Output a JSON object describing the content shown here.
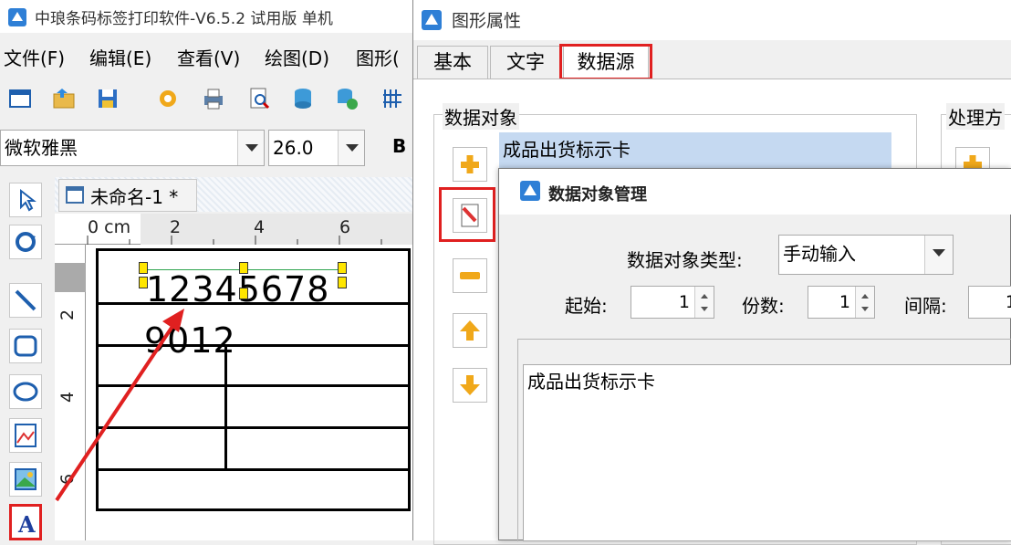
{
  "main_window": {
    "title": "中琅条码标签打印软件-V6.5.2 试用版 单机",
    "menu": [
      "文件(F)",
      "编辑(E)",
      "查看(V)",
      "绘图(D)",
      "图形("
    ],
    "font": {
      "family": "微软雅黑",
      "size": "26.0",
      "bold_label": "B"
    },
    "doc_tab": "未命名-1 *",
    "ruler": {
      "unit": "0 cm",
      "top_ticks": [
        "2",
        "4",
        "6"
      ],
      "left_ticks": [
        "2",
        "4",
        "6"
      ]
    },
    "label": {
      "text_line1": "12345678",
      "text_line2": "9012"
    }
  },
  "property_dialog": {
    "title": "图形属性",
    "tabs": [
      "基本",
      "文字",
      "数据源"
    ],
    "active_tab": "数据源",
    "group_label": "数据对象",
    "processing_label": "处理方",
    "data_item": "成品出货标示卡"
  },
  "data_manager": {
    "title": "数据对象管理",
    "type_label": "数据对象类型:",
    "type_value": "手动输入",
    "start_label": "起始:",
    "start_value": "1",
    "copies_label": "份数:",
    "copies_value": "1",
    "interval_label": "间隔:",
    "interval_value": "1",
    "content": "成品出货标示卡"
  },
  "colors": {
    "highlight": "#e02020",
    "handle": "#ffe600",
    "selection": "#c5d9f1"
  }
}
